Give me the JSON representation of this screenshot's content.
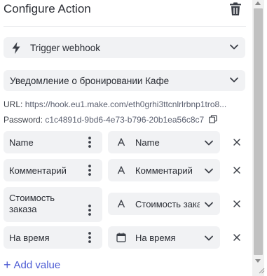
{
  "header": {
    "title": "Configure Action"
  },
  "trigger_select": {
    "icon": "lightning-icon",
    "label": "Trigger webhook"
  },
  "webhook_select": {
    "label": "Уведомление о бронировании Кафе"
  },
  "url": {
    "label": "URL:",
    "value": "https://hook.eu1.make.com/eth0grhi3ttcnlrlrbnp1tro8..."
  },
  "password": {
    "label": "Password:",
    "value": "c1c4891d-9bd6-4e73-b796-20b1ea56c8c7",
    "copy_icon": "copy-icon"
  },
  "mappings": [
    {
      "key": "Name",
      "value_icon": "text-icon",
      "value": "Name"
    },
    {
      "key": "Комментарий",
      "value_icon": "text-icon",
      "value": "Комментарий"
    },
    {
      "key": "Стоимость заказа",
      "value_icon": "text-icon",
      "value": "Стоимость заказа"
    },
    {
      "key": "На время",
      "value_icon": "calendar-icon",
      "value": "На время"
    }
  ],
  "add_value": {
    "plus": "+",
    "label": "Add value"
  },
  "colors": {
    "accent": "#4c5bd4",
    "field_bg": "#f1f2f4"
  }
}
